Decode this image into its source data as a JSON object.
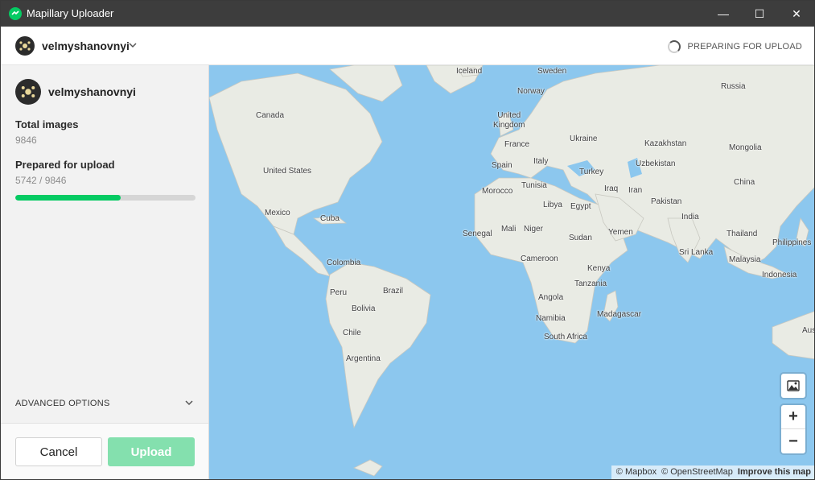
{
  "window": {
    "title": "Mapillary Uploader",
    "controls": {
      "minimize": "—",
      "maximize": "☐",
      "close": "✕"
    }
  },
  "header": {
    "username": "velmyshanovnyi",
    "status": "PREPARING FOR UPLOAD"
  },
  "sidebar": {
    "username": "velmyshanovnyi",
    "total_images_label": "Total images",
    "total_images_value": "9846",
    "prepared_label": "Prepared for upload",
    "prepared_value": "5742 / 9846",
    "progress_fraction": 0.583,
    "advanced_options": "ADVANCED OPTIONS",
    "cancel_label": "Cancel",
    "upload_label": "Upload"
  },
  "map": {
    "countries": [
      "Iceland",
      "Sweden",
      "Norway",
      "Russia",
      "Canada",
      "United Kingdom",
      "Ukraine",
      "Kazakhstan",
      "France",
      "Mongolia",
      "Spain",
      "Italy",
      "Uzbekistan",
      "United States",
      "Turkey",
      "China",
      "Morocco",
      "Tunisia",
      "Iraq",
      "Iran",
      "Pakistan",
      "Libya",
      "Egypt",
      "Mexico",
      "Cuba",
      "India",
      "Senegal",
      "Mali",
      "Niger",
      "Sudan",
      "Yemen",
      "Thailand",
      "Philippines",
      "Sri Lanka",
      "Colombia",
      "Cameroon",
      "Malaysia",
      "Kenya",
      "Indonesia",
      "Peru",
      "Brazil",
      "Tanzania",
      "Bolivia",
      "Angola",
      "Madagascar",
      "Namibia",
      "Chile",
      "South Africa",
      "Argentina",
      "Aus"
    ],
    "zoom_in": "+",
    "zoom_out": "−",
    "attribution": {
      "mapbox": "© Mapbox",
      "osm": "© OpenStreetMap",
      "improve": "Improve this map"
    }
  },
  "colors": {
    "accent": "#05cb63",
    "water": "#8cc7ee",
    "land": "#e9ebe4",
    "titlebar": "#3d3d3d"
  },
  "icons": [
    "mapillary-logo-icon",
    "avatar-icon",
    "chevron-down-icon",
    "spinner-icon",
    "map-style-icon"
  ]
}
